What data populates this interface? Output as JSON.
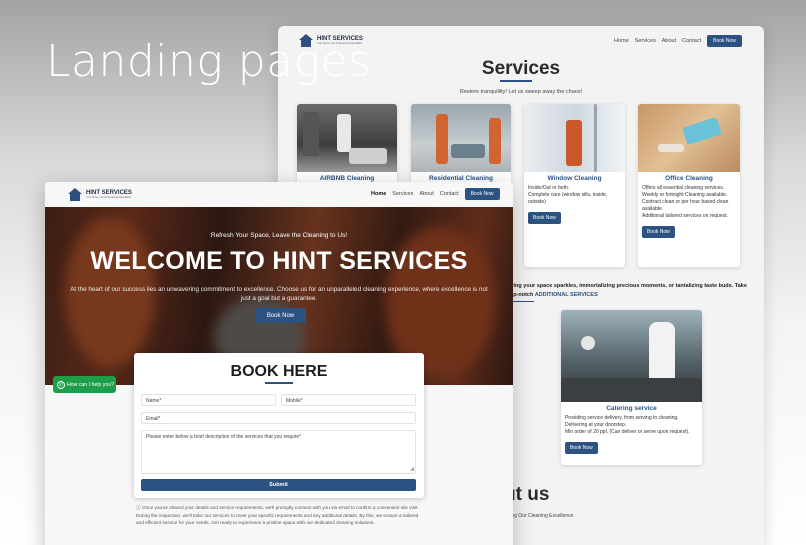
{
  "heading": "Landing pages",
  "colors": {
    "accent": "#2c5282",
    "whatsapp": "#1e9e48"
  },
  "brand": {
    "name": "HINT SERVICES",
    "tagline": "Your Home, Our Professional Specialists"
  },
  "nav": {
    "home": "Home",
    "services": "Services",
    "about": "About",
    "contact": "Contact",
    "cta": "Book Now"
  },
  "services_page": {
    "title": "Services",
    "subtitle": "Restore tranquillity! Let us sweep away the chaos!",
    "cards": [
      {
        "title": "AIRBNB Cleaning"
      },
      {
        "title": "Residential Cleaning"
      },
      {
        "title": "Window Cleaning",
        "desc": [
          "Inside/Out or both.",
          "Complete care (window sills, inside, outside)"
        ],
        "btn": "Book Now"
      },
      {
        "title": "Office Cleaning",
        "desc": [
          "Offers all essential cleaning services.",
          "Weekly or fortnight Cleaning available.",
          "Contract clean or per hour based clean available.",
          "Additional tailored services on request."
        ],
        "btn": "Book Now"
      }
    ],
    "additional": {
      "line1": "uring your space sparkles, immortalizing precious moments, or tantalizing taste buds. Take",
      "line2": "top-notch",
      "highlight": "ADDITIONAL SERVICES"
    },
    "catering": {
      "title": "Catering service",
      "desc": [
        "Providing service delivery, from serving to cleaning.",
        "Delivering at your doorstep.",
        "Min order of 20 ppl. (Can deliver or serve upon request)."
      ],
      "btn": "Book Now"
    },
    "about": {
      "title": "ut us",
      "subtitle": "iling Our Cleaning Excellence",
      "mark": "I"
    }
  },
  "landing": {
    "pre_title": "Refresh Your Space, Leave the Cleaning to Us!",
    "title": "WELCOME TO HINT SERVICES",
    "description": "At the heart of our success lies an unwavering commitment to excellence. Choose us for an unparalleled cleaning experience, where excellence is not just a goal but a guarantee.",
    "cta": "Book Now",
    "whatsapp": "How can I help you?",
    "book": {
      "title": "BOOK HERE",
      "name": "Name*",
      "mobile": "Mobile*",
      "email": "Email*",
      "message": "Please enter below a brief description of the services that you require*",
      "submit": "Submit"
    },
    "note": "Once you've shared your details and service requirements, we'll promptly connect with you via email to confirm a convenient site visit. During the inspection, we'll tailor our services to meet your specific requirements and any additional details. By this, we ensure a tailored and efficient service for your needs. Get ready to experience a pristine space with our dedicated cleaning solutions."
  }
}
